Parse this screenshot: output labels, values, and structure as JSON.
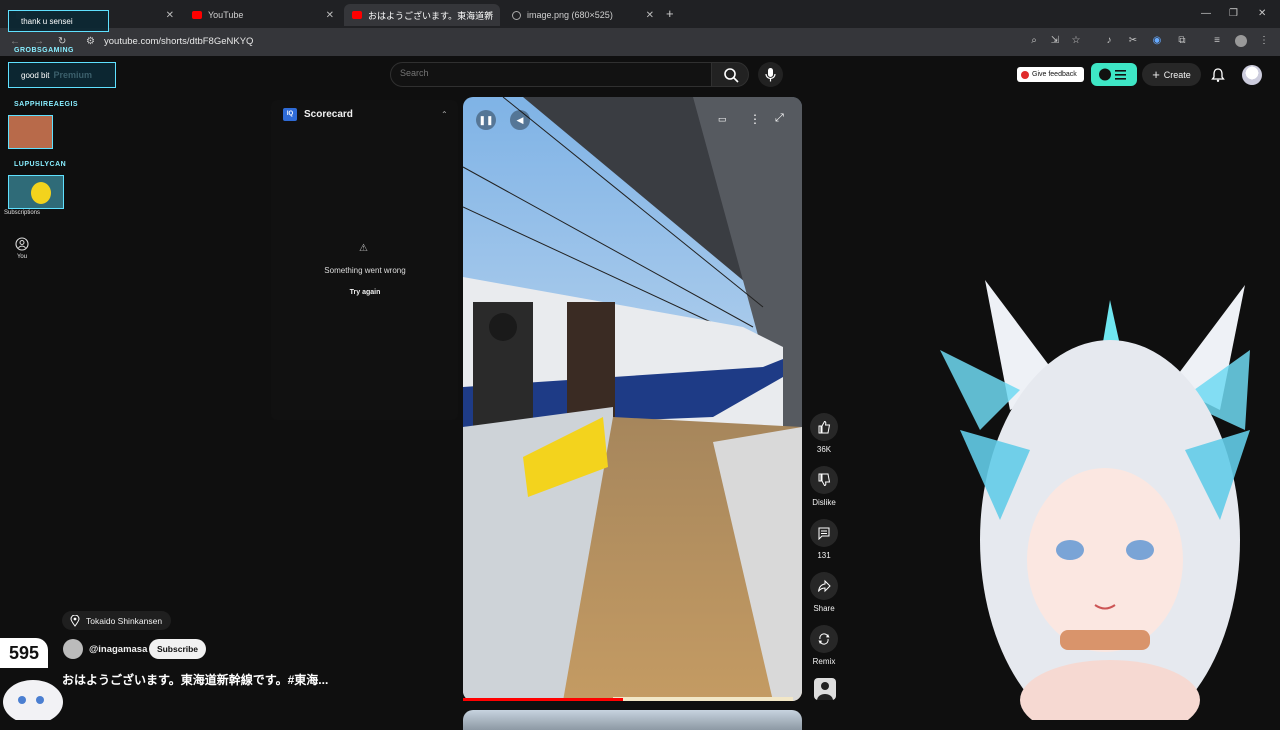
{
  "browser": {
    "tabs": [
      {
        "label": "",
        "active": false
      },
      {
        "label": "YouTube",
        "active": false
      },
      {
        "label": "おはようございます。東海道新",
        "active": true
      },
      {
        "label": "image.png (680×525)",
        "active": false
      }
    ],
    "new_tab": "+",
    "url": "youtube.com/shorts/dtbF8GeNKYQ"
  },
  "header": {
    "search_placeholder": "Search",
    "feedback_label": "Give feedback",
    "create_label": "Create"
  },
  "sidebar": {
    "items": [
      {
        "label": "Subscriptions",
        "icon": "subscriptions-icon"
      },
      {
        "label": "You",
        "icon": "you-icon"
      }
    ]
  },
  "scorecard": {
    "title": "Scorecard",
    "error": "Something went wrong",
    "retry": "Try again"
  },
  "actions": {
    "like": "36K",
    "dislike": "Dislike",
    "comments": "131",
    "share": "Share",
    "remix": "Remix"
  },
  "short": {
    "location": "Tokaido Shinkansen",
    "channel": "@inagamasa",
    "subscribe": "Subscribe",
    "caption": "おはようございます。東海道新幹線です。#東海..."
  },
  "overlay": {
    "chat": [
      {
        "message": "thank u sensei"
      },
      {
        "user": "GROBSGAMING",
        "message": "good bit"
      },
      {
        "user": "SAPPHIREAEGIS"
      },
      {
        "user": "LUPUSLYCAN"
      }
    ],
    "premium_text": "Premium",
    "counter": "595"
  },
  "colors": {
    "accent_red": "#ff0000",
    "cyan": "#5fe1ff",
    "ext_green": "#3ee6c5"
  }
}
